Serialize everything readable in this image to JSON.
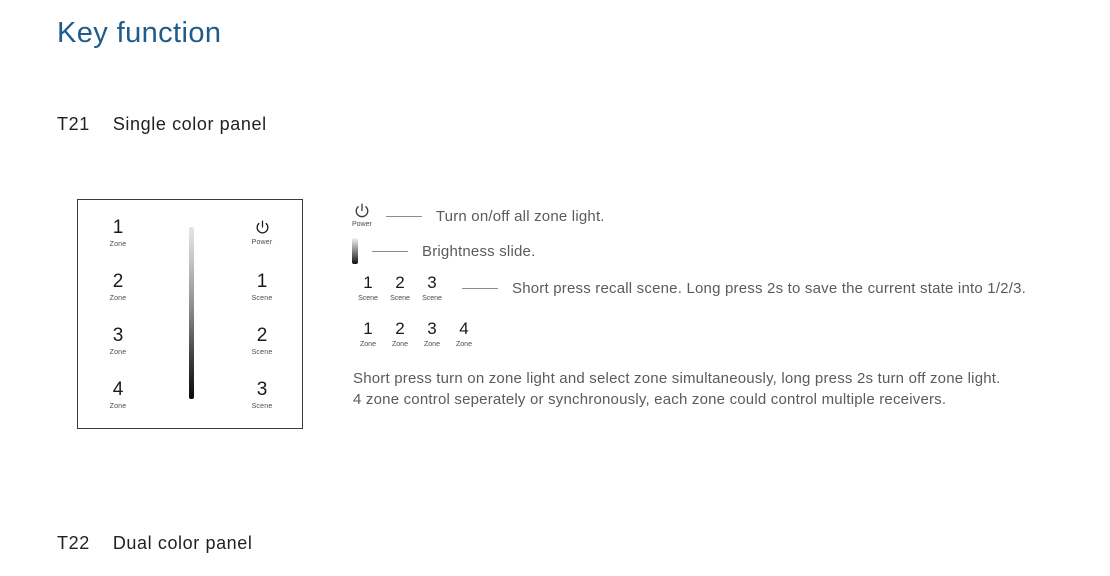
{
  "page": {
    "title": "Key function"
  },
  "sections": [
    {
      "code": "T21",
      "name": "Single color panel"
    },
    {
      "code": "T22",
      "name": "Dual color panel"
    }
  ],
  "device_panel": {
    "left_keys": [
      {
        "number": "1",
        "caption": "Zone"
      },
      {
        "number": "2",
        "caption": "Zone"
      },
      {
        "number": "3",
        "caption": "Zone"
      },
      {
        "number": "4",
        "caption": "Zone"
      }
    ],
    "right_keys": [
      {
        "number": "",
        "caption": "Power",
        "icon": "power-icon"
      },
      {
        "number": "1",
        "caption": "Scene"
      },
      {
        "number": "2",
        "caption": "Scene"
      },
      {
        "number": "3",
        "caption": "Scene"
      }
    ],
    "slider": {
      "name": "brightness-slider",
      "top_color": "#e6e6e6",
      "bottom_color": "#0a0a0a"
    }
  },
  "legend": {
    "power": {
      "icon": "power-icon",
      "icon_caption": "Power",
      "description": "Turn on/off all zone light."
    },
    "brightness": {
      "icon": "gradient-bar-icon",
      "description": "Brightness slide."
    },
    "scene": {
      "keys": [
        {
          "number": "1",
          "caption": "Scene"
        },
        {
          "number": "2",
          "caption": "Scene"
        },
        {
          "number": "3",
          "caption": "Scene"
        }
      ],
      "description": "Short press recall scene. Long press 2s to save the current state into 1/2/3."
    },
    "zone": {
      "keys": [
        {
          "number": "1",
          "caption": "Zone"
        },
        {
          "number": "2",
          "caption": "Zone"
        },
        {
          "number": "3",
          "caption": "Zone"
        },
        {
          "number": "4",
          "caption": "Zone"
        }
      ],
      "description_line1": "Short press turn on zone light and select zone simultaneously, long press 2s turn off zone light.",
      "description_line2": "4 zone control seperately or synchronously, each zone could control multiple receivers."
    }
  },
  "colors": {
    "heading_blue": "#1f5c8b",
    "body_text": "#5b5b5b",
    "dark_text": "#231f20"
  }
}
